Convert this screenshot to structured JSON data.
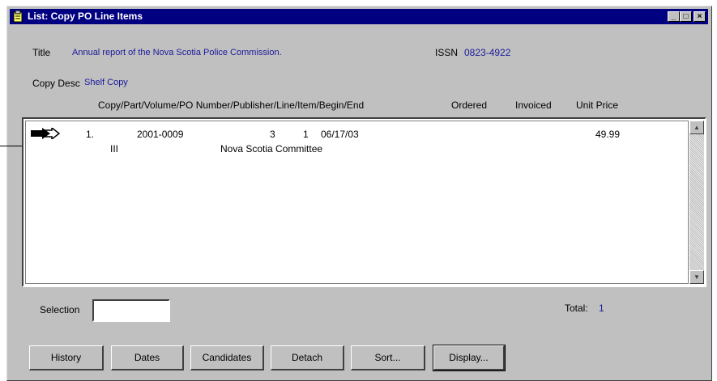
{
  "window": {
    "title": "List: Copy  PO Line Items",
    "controls": {
      "minimize": "_",
      "maximize": "□",
      "close": "×"
    }
  },
  "record": {
    "title_label": "Title",
    "title_value": "Annual report of the Nova Scotia Police Commission.",
    "issn_label": "ISSN",
    "issn_value": "0823-4922",
    "copy_desc_label": "Copy Desc",
    "copy_desc_value": "Shelf Copy"
  },
  "table": {
    "headers": {
      "main": "Copy/Part/Volume/PO Number/Publisher/Line/Item/Begin/End",
      "ordered": "Ordered",
      "invoiced": "Invoiced",
      "unit_price": "Unit Price"
    },
    "rows": [
      {
        "number": "1.",
        "po": "2001-0009",
        "line": "3",
        "item": "1",
        "date": "06/17/03",
        "unit_price": "49.99",
        "sub_code": "III",
        "publisher": "Nova Scotia Committee"
      }
    ]
  },
  "footer": {
    "selection_label": "Selection",
    "selection_value": "",
    "total_label": "Total:",
    "total_value": "1"
  },
  "buttons": {
    "history": "History",
    "dates": "Dates",
    "candidates": "Candidates",
    "detach": "Detach",
    "sort": "Sort...",
    "display": "Display..."
  },
  "icons": {
    "window_icon": "document-icon",
    "row_pointer": "double-arrow-icon"
  }
}
